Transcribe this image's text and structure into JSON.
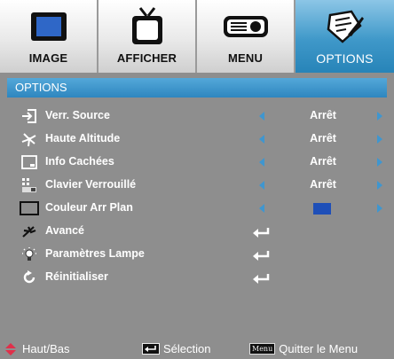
{
  "tabs": [
    {
      "label": "IMAGE",
      "icon": "monitor-icon"
    },
    {
      "label": "AFFICHER",
      "icon": "tv-icon"
    },
    {
      "label": "MENU",
      "icon": "projector-icon"
    },
    {
      "label": "OPTIONS",
      "icon": "settings-icon",
      "active": true
    }
  ],
  "panel": {
    "title": "OPTIONS",
    "rows": [
      {
        "label": "Verr. Source",
        "value": "Arrêt",
        "icon": "source-lock-icon"
      },
      {
        "label": "Haute Altitude",
        "value": "Arrêt",
        "icon": "fan-icon"
      },
      {
        "label": "Info Cachées",
        "value": "Arrêt",
        "icon": "info-hide-icon"
      },
      {
        "label": "Clavier Verrouillé",
        "value": "Arrêt",
        "icon": "keypad-lock-icon"
      },
      {
        "label": "Couleur Arr Plan",
        "swatch_color": "#1e4fb8",
        "icon": "background-color-icon"
      },
      {
        "label": "Avancé",
        "icon": "advanced-icon"
      },
      {
        "label": "Paramètres Lampe",
        "icon": "lamp-icon"
      },
      {
        "label": "Réinitialiser",
        "icon": "reset-icon"
      }
    ]
  },
  "footer": {
    "nav": "Haut/Bas",
    "select": "Sélection",
    "menu_key": "Menu",
    "quit": "Quitter le Menu"
  },
  "colors": {
    "accent": "#2e86bf",
    "background": "#8e8e8e",
    "arrow": "#3f96cf",
    "footer_arrow": "#e0304a"
  }
}
